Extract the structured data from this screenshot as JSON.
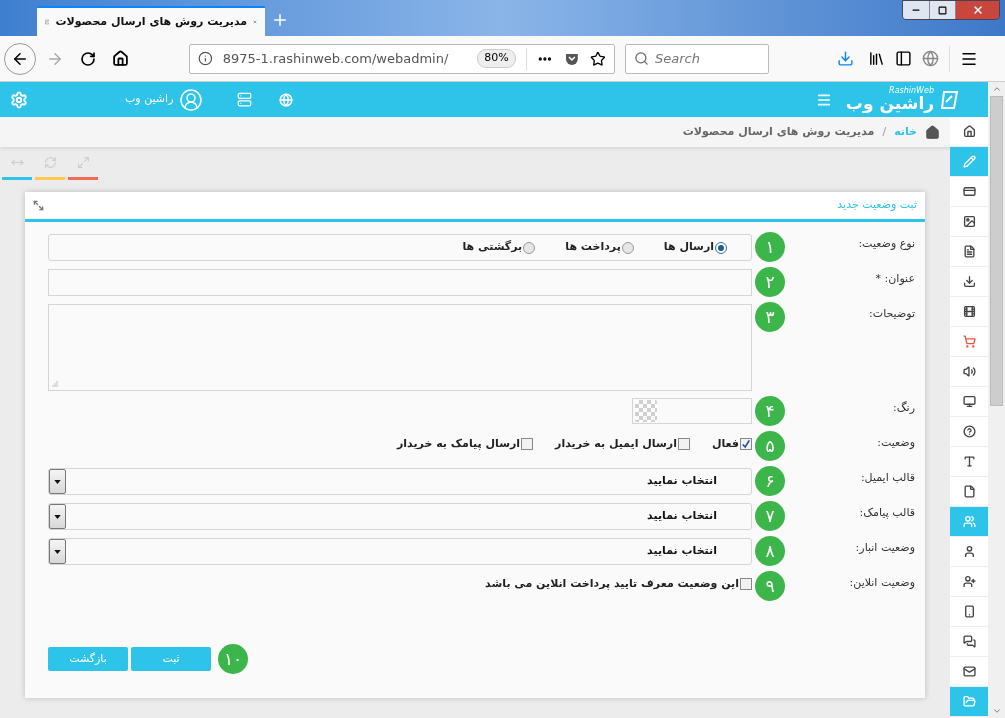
{
  "browser": {
    "tab_title": "مدیریت روش های ارسال محصولات",
    "url": "8975-1.rashinweb.com/webadmin/",
    "zoom": "80%",
    "search_placeholder": "Search"
  },
  "header": {
    "logo": {
      "text": "راشین وب",
      "subtext": "RashinWeb"
    },
    "user_name": "راشین وب"
  },
  "breadcrumb": {
    "items": [
      "خانه",
      "مدیریت روش های ارسال محصولات"
    ],
    "separator": "/"
  },
  "toolbar": [
    {
      "color": "#2ec3e8"
    },
    {
      "color": "#ffc94b"
    },
    {
      "color": "#f26b54"
    }
  ],
  "sidebar": {
    "items": [
      {
        "selected": false
      },
      {
        "selected": true
      },
      {
        "selected": false
      },
      {
        "selected": false
      },
      {
        "selected": false
      },
      {
        "selected": false
      },
      {
        "selected": false
      },
      {
        "selected": false
      },
      {
        "selected": false
      },
      {
        "selected": false
      },
      {
        "selected": false
      },
      {
        "selected": false
      },
      {
        "selected": false
      },
      {
        "selected": true
      },
      {
        "selected": false
      },
      {
        "selected": false
      },
      {
        "selected": false
      },
      {
        "selected": false
      },
      {
        "selected": false
      },
      {
        "selected": true
      }
    ]
  },
  "card": {
    "title": "ثبت وضعیت جدید"
  },
  "form": {
    "fields": [
      {
        "kind": "radio",
        "label": "نوع وضعیت:",
        "badge": "۱",
        "options": [
          {
            "label": "ارسال ها",
            "selected": true
          },
          {
            "label": "پرداخت ها",
            "selected": false
          },
          {
            "label": "برگشتی ها",
            "selected": false
          }
        ]
      },
      {
        "kind": "text",
        "label": "عنوان: *",
        "badge": "۲"
      },
      {
        "kind": "textarea",
        "label": "توضیحات:",
        "badge": "۳"
      },
      {
        "kind": "color",
        "label": "رنگ:",
        "badge": "۴"
      },
      {
        "kind": "checkboxes",
        "label": "وضعیت:",
        "badge": "۵",
        "options": [
          {
            "label": "فعال",
            "checked": true
          },
          {
            "label": "ارسال ایمیل به خریدار",
            "checked": false
          },
          {
            "label": "ارسال پیامک به خریدار",
            "checked": false
          }
        ]
      },
      {
        "kind": "select",
        "label": "قالب ایمیل:",
        "badge": "۶",
        "value": "انتخاب نمایید"
      },
      {
        "kind": "select",
        "label": "قالب پیامک:",
        "badge": "۷",
        "value": "انتخاب نمایید"
      },
      {
        "kind": "select",
        "label": "وضعیت انبار:",
        "badge": "۸",
        "value": "انتخاب نمایید"
      },
      {
        "kind": "checkboxes",
        "label": "وضعیت انلاین:",
        "badge": "۹",
        "options": [
          {
            "label": "این وضعیت معرف تایید پرداخت انلاین می باشد",
            "checked": false
          }
        ]
      }
    ],
    "buttons": [
      "ثبت",
      "بازگشت"
    ],
    "buttons_badge": "۱۰"
  }
}
